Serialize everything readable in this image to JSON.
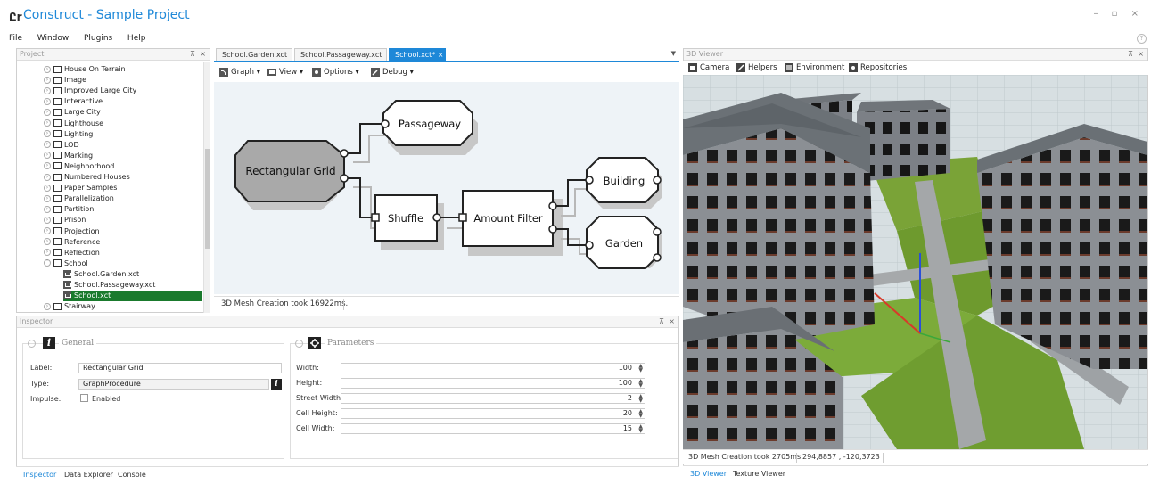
{
  "app": {
    "logo": "Ըr",
    "title": "Construct - Sample Project"
  },
  "window_controls": "– ▫ ×",
  "menu": {
    "items": [
      "File",
      "Window",
      "Plugins",
      "Help"
    ]
  },
  "project": {
    "header": "Project",
    "items": [
      {
        "label": "House On Terrain",
        "type": "folder",
        "level": 1
      },
      {
        "label": "Image",
        "type": "folder",
        "level": 1
      },
      {
        "label": "Improved Large City",
        "type": "folder",
        "level": 1
      },
      {
        "label": "Interactive",
        "type": "folder",
        "level": 1
      },
      {
        "label": "Large City",
        "type": "folder",
        "level": 1
      },
      {
        "label": "Lighthouse",
        "type": "folder",
        "level": 1
      },
      {
        "label": "Lighting",
        "type": "folder",
        "level": 1
      },
      {
        "label": "LOD",
        "type": "folder",
        "level": 1
      },
      {
        "label": "Marking",
        "type": "folder",
        "level": 1
      },
      {
        "label": "Neighborhood",
        "type": "folder",
        "level": 1
      },
      {
        "label": "Numbered Houses",
        "type": "folder",
        "level": 1
      },
      {
        "label": "Paper Samples",
        "type": "folder",
        "level": 1
      },
      {
        "label": "Parallelization",
        "type": "folder",
        "level": 1
      },
      {
        "label": "Partition",
        "type": "folder",
        "level": 1
      },
      {
        "label": "Prison",
        "type": "folder",
        "level": 1
      },
      {
        "label": "Projection",
        "type": "folder",
        "level": 1
      },
      {
        "label": "Reference",
        "type": "folder",
        "level": 1
      },
      {
        "label": "Reflection",
        "type": "folder",
        "level": 1
      },
      {
        "label": "School",
        "type": "folder-open",
        "level": 1
      },
      {
        "label": "School.Garden.xct",
        "type": "file",
        "level": 2
      },
      {
        "label": "School.Passageway.xct",
        "type": "file",
        "level": 2
      },
      {
        "label": "School.xct",
        "type": "file",
        "level": 2,
        "selected": true
      },
      {
        "label": "Stairway",
        "type": "folder",
        "level": 1
      }
    ]
  },
  "editor": {
    "tabs": [
      "School.Garden.xct",
      "School.Passageway.xct",
      "School.xct*  ×"
    ],
    "toolbar": [
      "Graph",
      "View",
      "Options",
      "Debug"
    ],
    "nodes": {
      "rect_grid": "Rectangular Grid",
      "passageway": "Passageway",
      "shuffle": "Shuffle",
      "amount_filter": "Amount Filter",
      "building": "Building",
      "garden": "Garden"
    },
    "status": "3D Mesh Creation took 16922ms."
  },
  "inspector": {
    "header": "Inspector",
    "general": {
      "title": "General",
      "label_label": "Label:",
      "label_value": "Rectangular Grid",
      "type_label": "Type:",
      "type_value": "GraphProcedure",
      "impulse_label": "Impulse:",
      "impulse_check": "Enabled"
    },
    "parameters": {
      "title": "Parameters",
      "rows": [
        {
          "label": "Width:",
          "value": "100"
        },
        {
          "label": "Height:",
          "value": "100"
        },
        {
          "label": "Street Width:",
          "value": "2"
        },
        {
          "label": "Cell Height:",
          "value": "20"
        },
        {
          "label": "Cell Width:",
          "value": "15"
        }
      ]
    },
    "tabs": [
      "Inspector",
      "Data Explorer",
      "Console"
    ]
  },
  "viewer": {
    "header": "3D Viewer",
    "toolbar": [
      "Camera",
      "Helpers",
      "Environment",
      "Repositories"
    ],
    "status": "3D Mesh Creation took 2705ms.",
    "coords": "294,8857 , -120,3723",
    "tabs": [
      "3D Viewer",
      "Texture Viewer"
    ]
  },
  "colors": {
    "accent": "#1e88d8",
    "selection": "#1a7a2d"
  }
}
